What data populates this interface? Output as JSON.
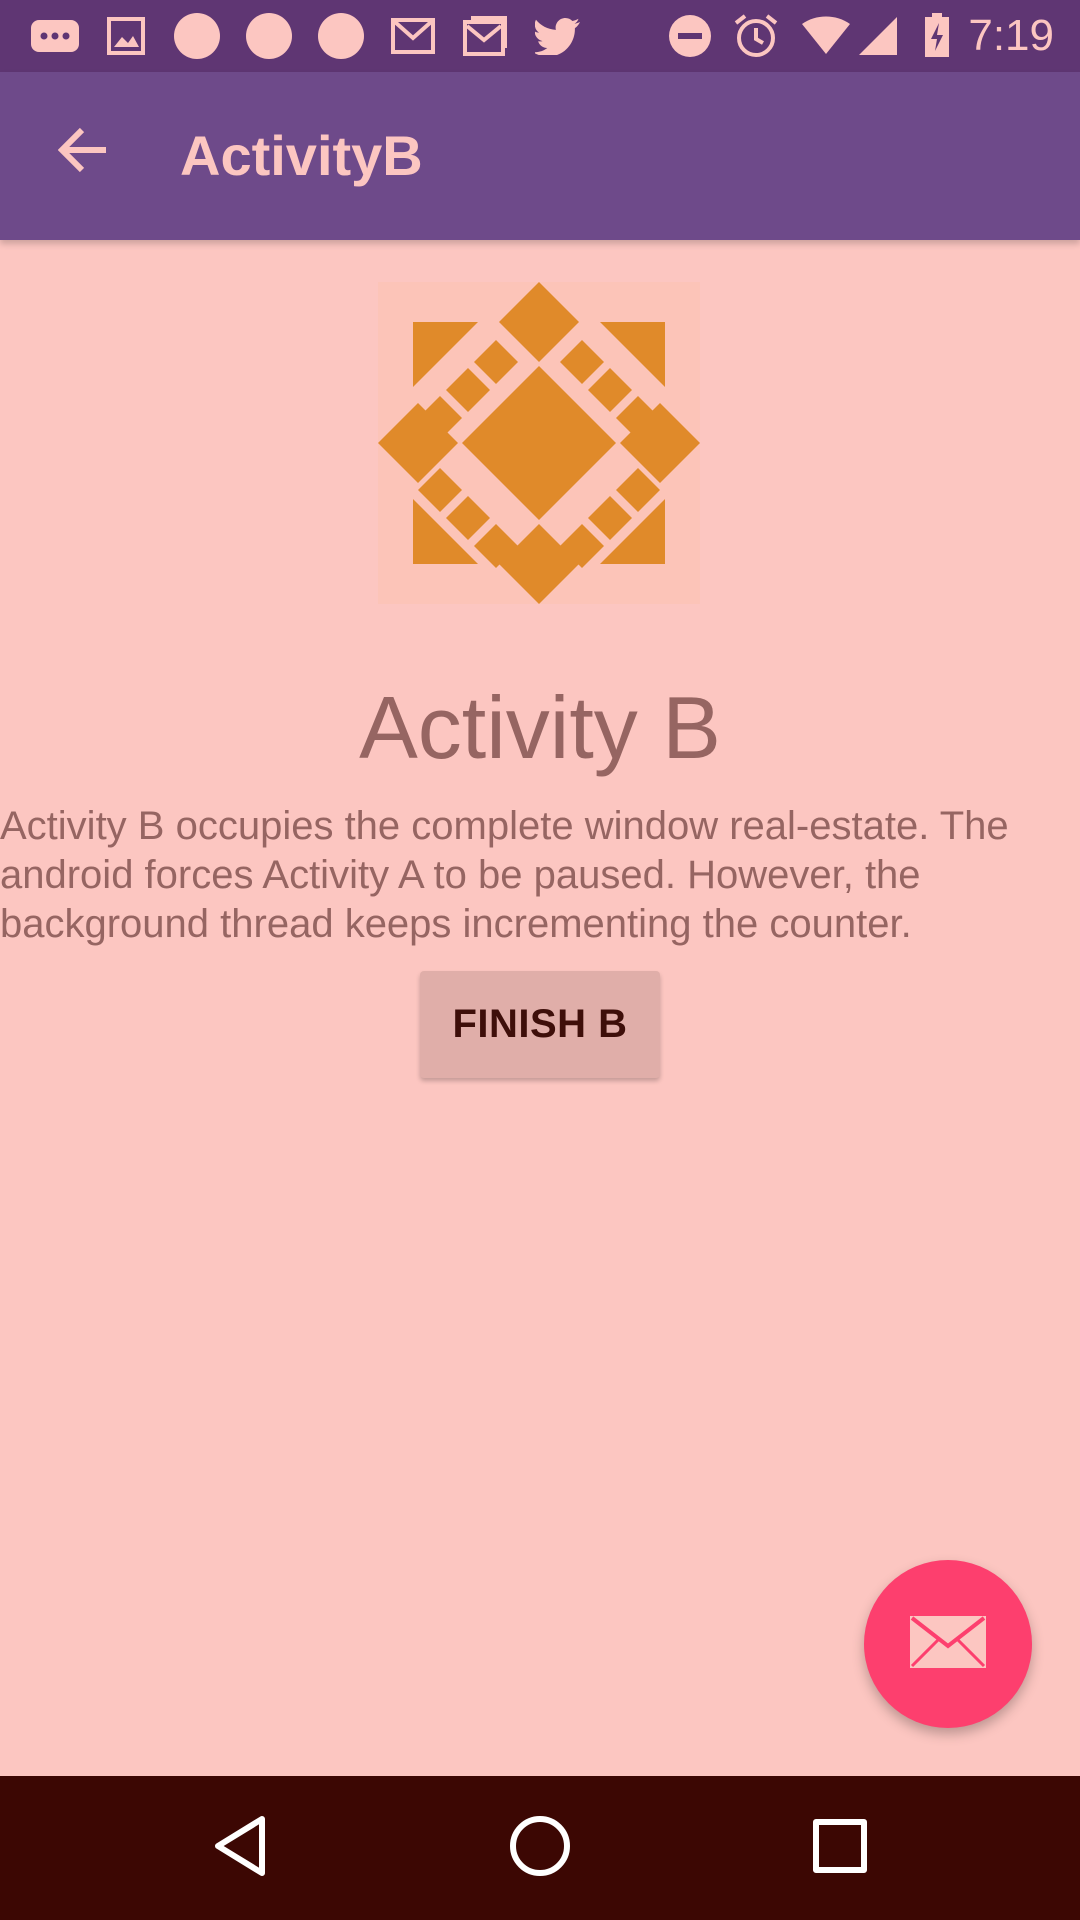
{
  "status_bar": {
    "time": "7:19",
    "icons": [
      "messages-icon",
      "image-icon",
      "notification-dot-icon",
      "notification-dot-icon",
      "notification-dot-icon",
      "gmail-icon",
      "inbox-icon",
      "twitter-icon",
      "do-not-disturb-icon",
      "alarm-icon",
      "wifi-icon",
      "signal-icon",
      "battery-charging-icon"
    ]
  },
  "app_bar": {
    "title": "ActivityB",
    "back_icon": "arrow-back-icon"
  },
  "content": {
    "heading": "Activity B",
    "description": "Activity B occupies the complete window real-estate. The android forces Activity A to be paused. However, the background thread keeps incrementing the counter.",
    "finish_button": "FINISH B",
    "logo_icon": "diamond-pattern-logo"
  },
  "fab": {
    "icon": "email-icon"
  },
  "nav_bar": {
    "icons": [
      "back-triangle-icon",
      "home-circle-icon",
      "recents-square-icon"
    ]
  },
  "colors": {
    "status_bar": "#5f3673",
    "app_bar": "#6e4a8a",
    "background": "#fcc6c1",
    "accent": "#fd3f6e",
    "logo": "#e08a2a",
    "nav_bar": "#3c0703"
  }
}
